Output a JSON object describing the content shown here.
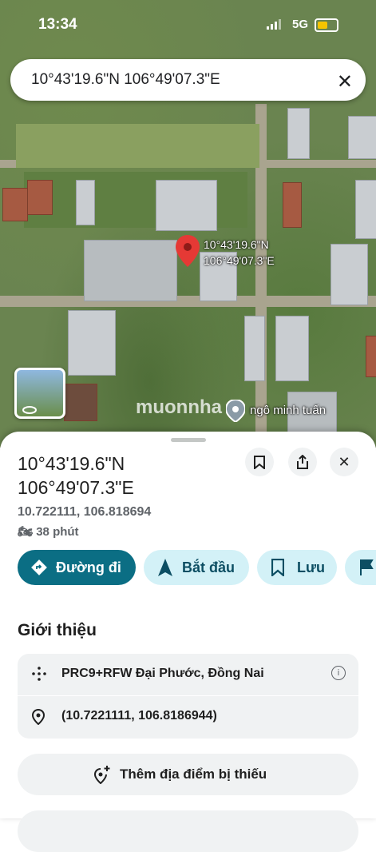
{
  "status_bar": {
    "time": "13:34",
    "network": "5G"
  },
  "search": {
    "query": "10°43'19.6\"N 106°49'07.3\"E"
  },
  "map": {
    "pin_label_line1": "10°43'19.6\"N",
    "pin_label_line2": "106°49'07.3\"E",
    "watermark": "muonnha",
    "poi_label": "ngô minh tuấn"
  },
  "place": {
    "title_line1": "10°43'19.6\"N",
    "title_line2": "106°49'07.3\"E",
    "decimal_coords": "10.722111, 106.818694",
    "travel_time": "38 phút"
  },
  "actions": [
    {
      "label": "Đường đi"
    },
    {
      "label": "Bắt đầu"
    },
    {
      "label": "Lưu"
    }
  ],
  "about": {
    "heading": "Giới thiệu",
    "plus_code": "PRC9+RFW Đại Phước, Đồng Nai",
    "coordinates": "(10.7221111, 106.8186944)"
  },
  "add_missing_place": "Thêm địa điểm bị thiếu",
  "colors": {
    "primary": "#0b6e84",
    "secondary_bg": "#d3f1f7",
    "pin": "#e53935"
  }
}
